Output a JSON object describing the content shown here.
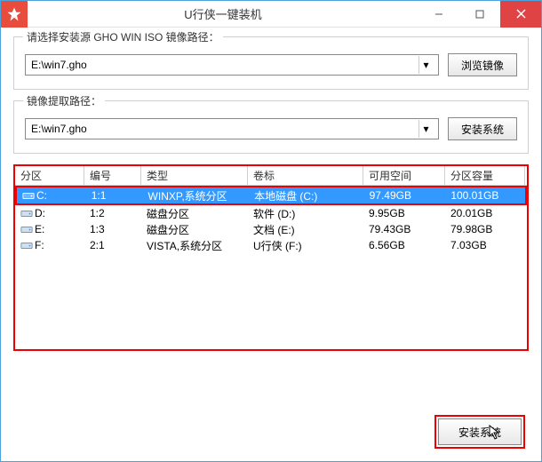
{
  "titlebar": {
    "title": "U行侠一键装机"
  },
  "group1": {
    "label": "请选择安装源 GHO WIN ISO 镜像路径：",
    "path": "E:\\win7.gho",
    "browse": "浏览镜像"
  },
  "group2": {
    "label": "镜像提取路径：",
    "path": "E:\\win7.gho",
    "install": "安装系统"
  },
  "table": {
    "headers": [
      "分区",
      "编号",
      "类型",
      "卷标",
      "可用空间",
      "分区容量"
    ],
    "rows": [
      {
        "selected": true,
        "cells": [
          "C:",
          "1:1",
          "WINXP,系统分区",
          "本地磁盘 (C:)",
          "97.49GB",
          "100.01GB"
        ]
      },
      {
        "selected": false,
        "cells": [
          "D:",
          "1:2",
          "磁盘分区",
          "软件 (D:)",
          "9.95GB",
          "20.01GB"
        ]
      },
      {
        "selected": false,
        "cells": [
          "E:",
          "1:3",
          "磁盘分区",
          "文档 (E:)",
          "79.43GB",
          "79.98GB"
        ]
      },
      {
        "selected": false,
        "cells": [
          "F:",
          "2:1",
          "VISTA,系统分区",
          "U行侠 (F:)",
          "6.56GB",
          "7.03GB"
        ]
      }
    ]
  },
  "footer": {
    "install": "安装系统"
  }
}
